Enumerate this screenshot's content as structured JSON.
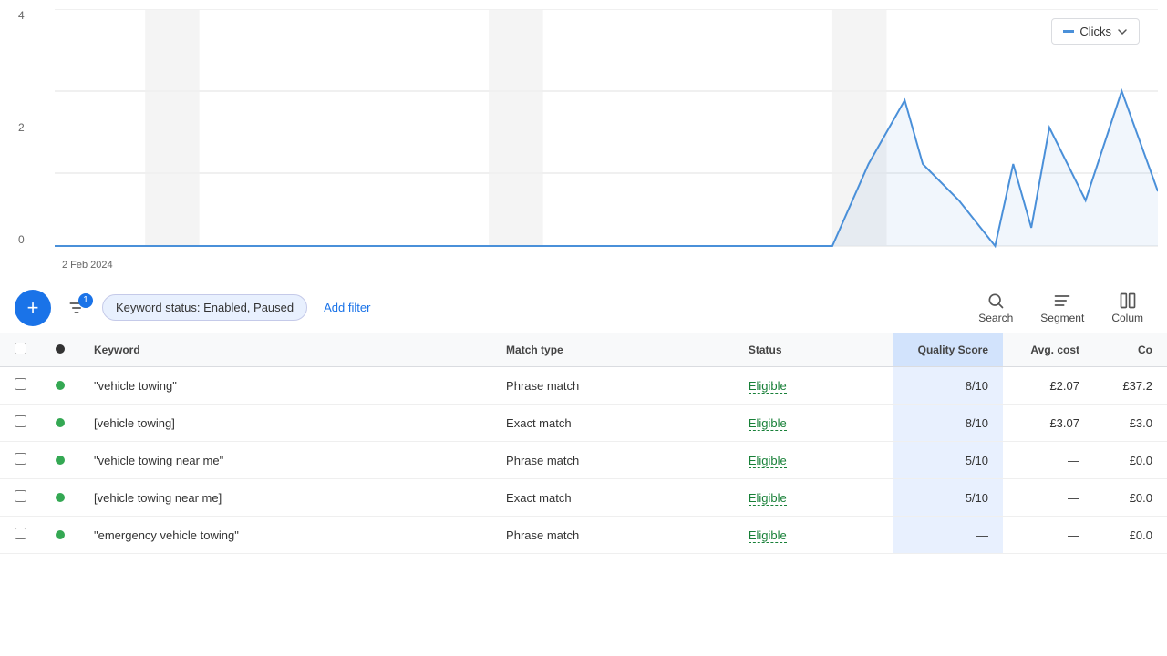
{
  "chart": {
    "y_labels": [
      "4",
      "2",
      "0"
    ],
    "date_label": "2 Feb 2024",
    "clicks_button_label": "Clicks"
  },
  "toolbar": {
    "filter_badge": "1",
    "keyword_status_filter": "Keyword status: Enabled, Paused",
    "add_filter_label": "Add filter",
    "search_label": "Search",
    "segment_label": "Segment",
    "columns_label": "Colum"
  },
  "table": {
    "headers": [
      {
        "id": "checkbox",
        "label": ""
      },
      {
        "id": "dot",
        "label": ""
      },
      {
        "id": "keyword",
        "label": "Keyword"
      },
      {
        "id": "match_type",
        "label": "Match type"
      },
      {
        "id": "status",
        "label": "Status"
      },
      {
        "id": "quality_score",
        "label": "Quality Score",
        "align": "right"
      },
      {
        "id": "avg_cost",
        "label": "Avg. cost",
        "align": "right"
      },
      {
        "id": "co",
        "label": "Co",
        "align": "right"
      }
    ],
    "rows": [
      {
        "keyword": "\"vehicle towing\"",
        "match_type": "Phrase match",
        "status": "Eligible",
        "quality_score": "8/10",
        "avg_cost": "£2.07",
        "co": "£37.2"
      },
      {
        "keyword": "[vehicle towing]",
        "match_type": "Exact match",
        "status": "Eligible",
        "quality_score": "8/10",
        "avg_cost": "£3.07",
        "co": "£3.0"
      },
      {
        "keyword": "\"vehicle towing near me\"",
        "match_type": "Phrase match",
        "status": "Eligible",
        "quality_score": "5/10",
        "avg_cost": "—",
        "co": "£0.0"
      },
      {
        "keyword": "[vehicle towing near me]",
        "match_type": "Exact match",
        "status": "Eligible",
        "quality_score": "5/10",
        "avg_cost": "—",
        "co": "£0.0"
      },
      {
        "keyword": "\"emergency vehicle towing\"",
        "match_type": "Phrase match",
        "status": "Eligible",
        "quality_score": "—",
        "avg_cost": "—",
        "co": "£0.0"
      }
    ]
  }
}
